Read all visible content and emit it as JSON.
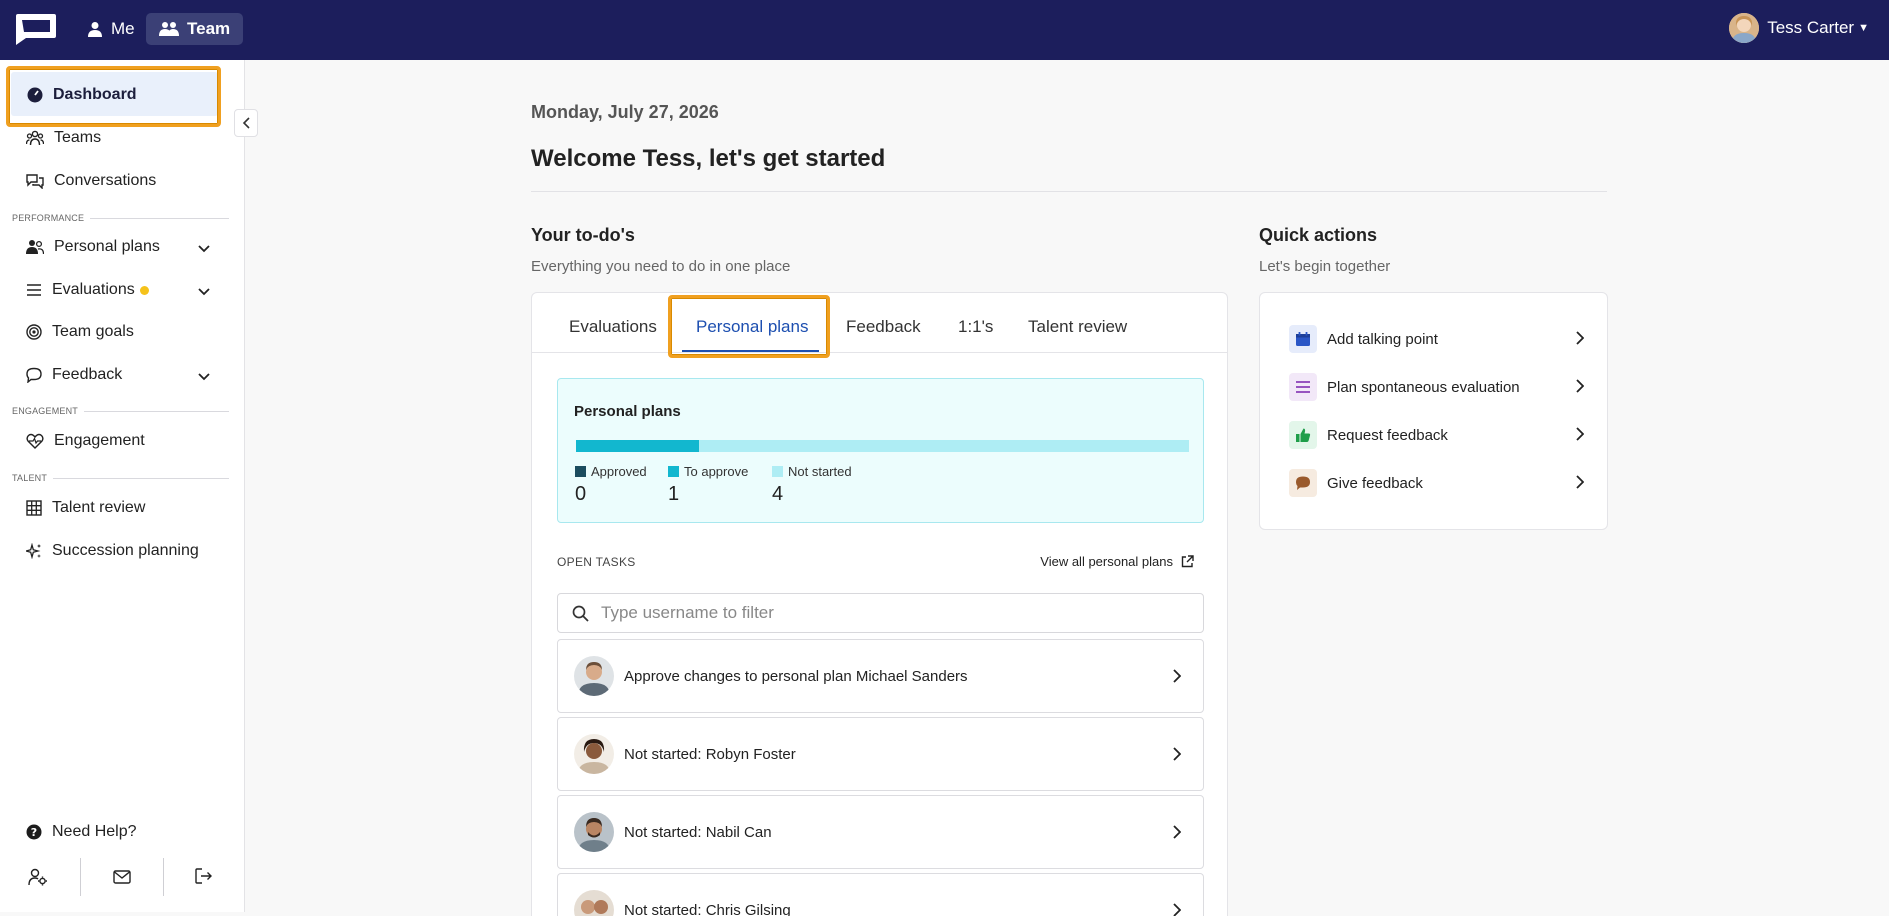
{
  "topbar": {
    "nav": [
      {
        "label": "Me",
        "icon": "user-icon"
      },
      {
        "label": "Team",
        "icon": "team-icon",
        "active": true
      }
    ],
    "user_name": "Tess Carter"
  },
  "sidebar": {
    "items": [
      {
        "label": "Dashboard",
        "icon": "dashboard-icon",
        "active": true
      },
      {
        "label": "Teams",
        "icon": "teams-icon"
      },
      {
        "label": "Conversations",
        "icon": "conversations-icon"
      },
      {
        "label": "Personal plans",
        "icon": "personal-plans-icon",
        "expandable": true
      },
      {
        "label": "Evaluations",
        "icon": "evaluations-icon",
        "expandable": true,
        "notification": true
      },
      {
        "label": "Team goals",
        "icon": "target-icon"
      },
      {
        "label": "Feedback",
        "icon": "feedback-icon",
        "expandable": true
      },
      {
        "label": "Engagement",
        "icon": "engagement-icon"
      },
      {
        "label": "Talent review",
        "icon": "grid-icon"
      },
      {
        "label": "Succession planning",
        "icon": "sparkle-icon"
      }
    ],
    "sections": {
      "performance": "PERFORMANCE",
      "engagement": "ENGAGEMENT",
      "talent": "TALENT"
    },
    "help": "Need Help?"
  },
  "main": {
    "date": "Monday, July 27, 2026",
    "welcome": "Welcome Tess, let's get started",
    "todo": {
      "title": "Your to-do's",
      "subtitle": "Everything you need to do in one place",
      "tabs": [
        "Evaluations",
        "Personal plans",
        "Feedback",
        "1:1's",
        "Talent review"
      ],
      "active_tab": "Personal plans"
    },
    "personal_plans": {
      "title": "Personal plans",
      "approved_label": "Approved",
      "to_approve_label": "To approve",
      "not_started_label": "Not started",
      "approved": "0",
      "to_approve": "1",
      "not_started": "4",
      "progress_fraction": 0.2,
      "colors": {
        "approved": "#1b4d5f",
        "to_approve": "#12b7cf",
        "not_started": "#aeedf4"
      }
    },
    "open_tasks_label": "OPEN TASKS",
    "view_all_label": "View all personal plans",
    "search_placeholder": "Type username to filter",
    "tasks": [
      "Approve changes to personal plan Michael Sanders",
      "Not started: Robyn Foster",
      "Not started: Nabil Can",
      "Not started: Chris Gilsing"
    ],
    "quick_actions": {
      "title": "Quick actions",
      "subtitle": "Let's begin together",
      "items": [
        {
          "label": "Add talking point",
          "icon": "calendar-icon",
          "color": "#2a56c6"
        },
        {
          "label": "Plan spontaneous evaluation",
          "icon": "list-icon",
          "color": "#8a3fb8"
        },
        {
          "label": "Request feedback",
          "icon": "thumbs-up-icon",
          "color": "#1f9e4a"
        },
        {
          "label": "Give feedback",
          "icon": "speech-bubble-icon",
          "color": "#9a5a2c"
        }
      ]
    }
  }
}
